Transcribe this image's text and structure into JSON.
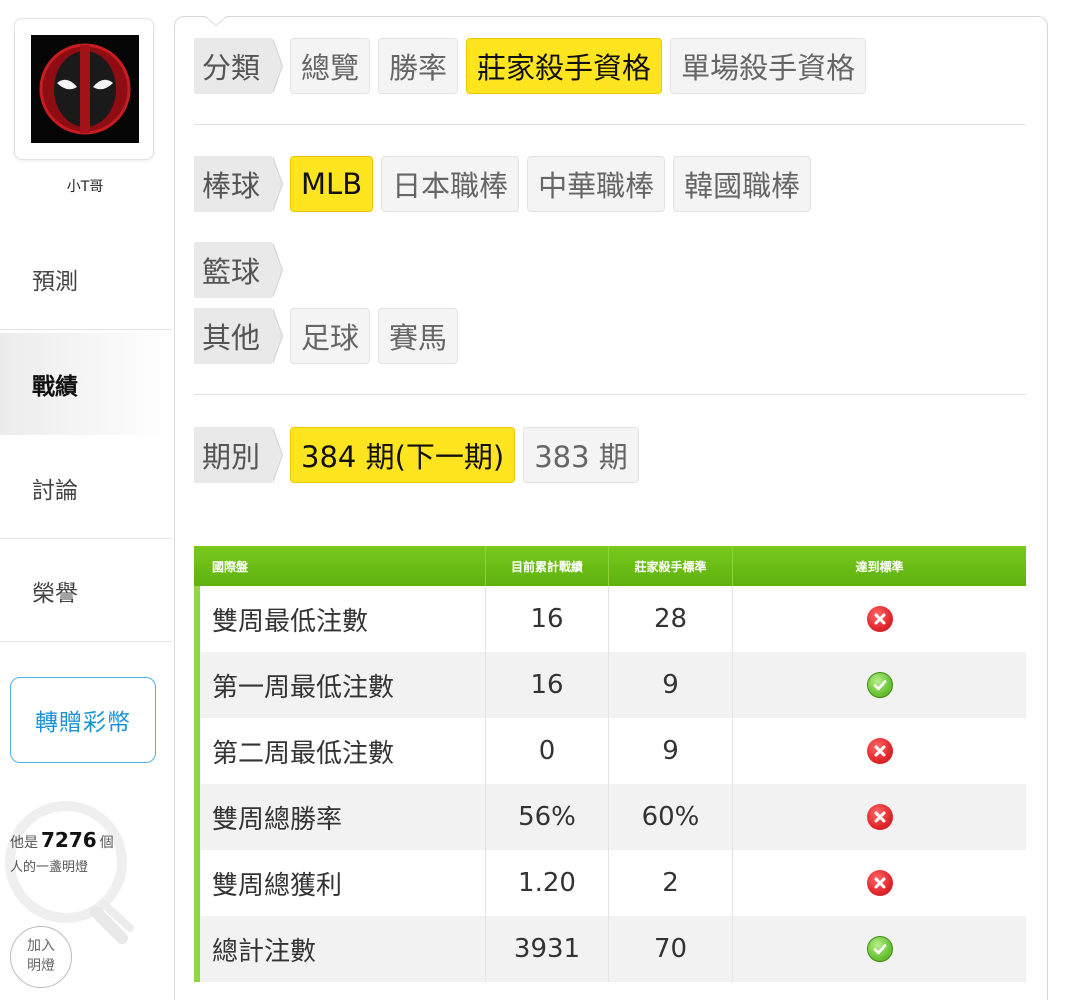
{
  "sidebar": {
    "username": "小T哥",
    "nav": [
      {
        "label": "預測"
      },
      {
        "label": "戰績"
      },
      {
        "label": "討論"
      },
      {
        "label": "榮譽"
      }
    ],
    "gift_button": "轉贈彩幣",
    "lamp": {
      "prefix": "他是",
      "count": "7276",
      "suffix": "個",
      "line2": "人的一盞明燈"
    },
    "join_button_line1": "加入",
    "join_button_line2": "明燈"
  },
  "filters": {
    "category": {
      "label": "分類",
      "options": [
        "總覽",
        "勝率",
        "莊家殺手資格",
        "單場殺手資格"
      ],
      "selected": "莊家殺手資格"
    },
    "baseball": {
      "label": "棒球",
      "options": [
        "MLB",
        "日本職棒",
        "中華職棒",
        "韓國職棒"
      ],
      "selected": "MLB"
    },
    "basketball": {
      "label": "籃球",
      "options": []
    },
    "other": {
      "label": "其他",
      "options": [
        "足球",
        "賽馬"
      ]
    },
    "period": {
      "label": "期別",
      "options": [
        "384 期(下一期)",
        "383 期"
      ],
      "selected": "384 期(下一期)"
    }
  },
  "table": {
    "headers": [
      "國際盤",
      "目前累計戰績",
      "莊家殺手標準",
      "達到標準"
    ],
    "rows": [
      {
        "name": "雙周最低注數",
        "current": "16",
        "standard": "28",
        "met": false
      },
      {
        "name": "第一周最低注數",
        "current": "16",
        "standard": "9",
        "met": true
      },
      {
        "name": "第二周最低注數",
        "current": "0",
        "standard": "9",
        "met": false
      },
      {
        "name": "雙周總勝率",
        "current": "56%",
        "standard": "60%",
        "met": false
      },
      {
        "name": "雙周總獲利",
        "current": "1.20",
        "standard": "2",
        "met": false
      },
      {
        "name": "總計注數",
        "current": "3931",
        "standard": "70",
        "met": true
      }
    ]
  },
  "colors": {
    "selected_chip": "#ffe51f",
    "table_header": "#6cbd15",
    "gift_blue": "#1a93d6",
    "fail_red": "#e0262b",
    "pass_green": "#6cc337"
  },
  "icons": {
    "fail": "x-circle-icon",
    "pass": "check-circle-icon"
  }
}
